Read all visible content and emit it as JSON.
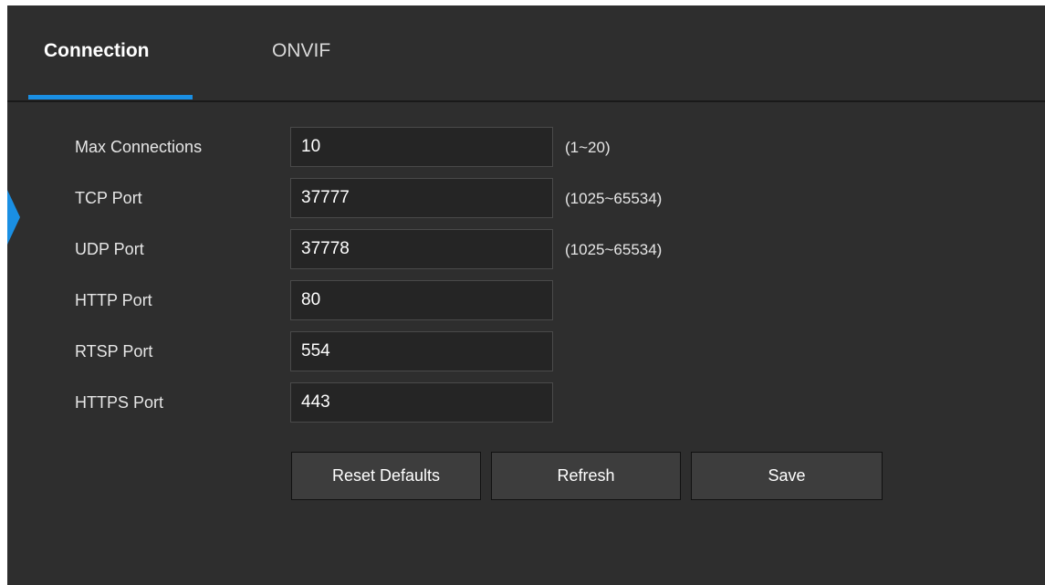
{
  "tabs": [
    {
      "label": "Connection",
      "active": true
    },
    {
      "label": "ONVIF",
      "active": false
    }
  ],
  "colors": {
    "panel_bg": "#2e2e2e",
    "accent": "#1a8fe3",
    "field_bg": "#252525",
    "button_bg": "#3d3d3d"
  },
  "form": {
    "rows": [
      {
        "label": "Max Connections",
        "value": "10",
        "range": "(1~20)"
      },
      {
        "label": "TCP Port",
        "value": "37777",
        "range": "(1025~65534)"
      },
      {
        "label": "UDP Port",
        "value": "37778",
        "range": "(1025~65534)"
      },
      {
        "label": "HTTP Port",
        "value": "80",
        "range": ""
      },
      {
        "label": "RTSP Port",
        "value": "554",
        "range": ""
      },
      {
        "label": "HTTPS Port",
        "value": "443",
        "range": ""
      }
    ]
  },
  "buttons": {
    "reset_label": "Reset Defaults",
    "refresh_label": "Refresh",
    "save_label": "Save"
  }
}
